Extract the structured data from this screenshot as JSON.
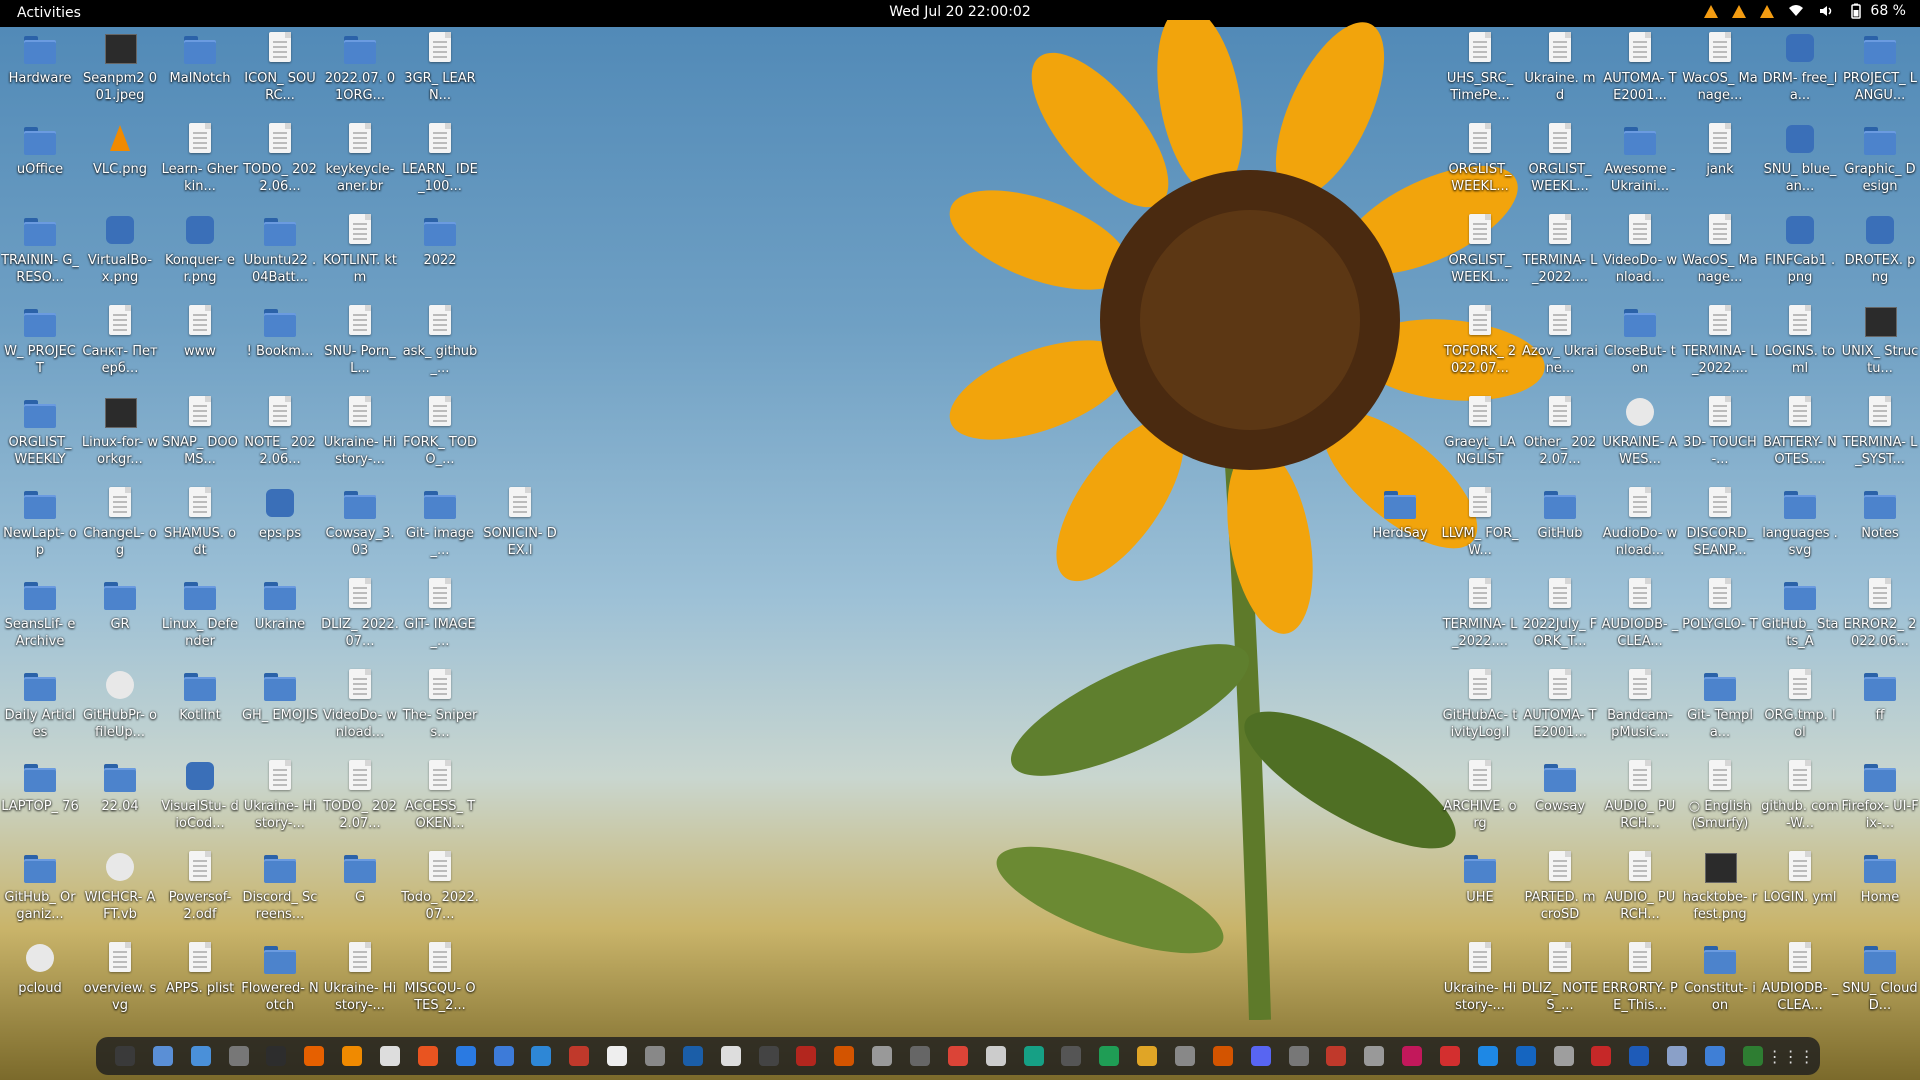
{
  "topbar": {
    "activities": "Activities",
    "clock": "Wed Jul 20  22:00:02",
    "battery": "68 %"
  },
  "desktop_left": [
    {
      "label": "Hardware",
      "icon": "folder-icon"
    },
    {
      "label": "Seanpm2 001.jpeg",
      "icon": "image-icon"
    },
    {
      "label": "MalNotch",
      "icon": "folder-icon"
    },
    {
      "label": "ICON_ SOURC...",
      "icon": "file-icon"
    },
    {
      "label": "2022.07. 01ORG...",
      "icon": "folder-icon"
    },
    {
      "label": "3GR_ LEARN...",
      "icon": "file-icon"
    },
    {
      "label": "uOffice",
      "icon": "folder-icon"
    },
    {
      "label": "VLC.png",
      "icon": "vlc-icon"
    },
    {
      "label": "Learn- Gherkin...",
      "icon": "file-icon"
    },
    {
      "label": "TODO_ 2022.06...",
      "icon": "file-icon"
    },
    {
      "label": "keykeycle- aner.br",
      "icon": "file-icon"
    },
    {
      "label": "LEARN_ IDE_100...",
      "icon": "file-icon"
    },
    {
      "label": "TRAININ- G_RESO...",
      "icon": "folder-icon"
    },
    {
      "label": "VirtualBo- x.png",
      "icon": "app-icon"
    },
    {
      "label": "Konquer- er.png",
      "icon": "app-icon"
    },
    {
      "label": "Ubuntu22 .04Batt...",
      "icon": "folder-icon"
    },
    {
      "label": "KOTLINT. ktm",
      "icon": "file-icon"
    },
    {
      "label": "2022",
      "icon": "folder-icon"
    },
    {
      "label": "W_ PROJECT",
      "icon": "folder-icon"
    },
    {
      "label": "Санкт- Петерб...",
      "icon": "file-icon"
    },
    {
      "label": "www",
      "icon": "file-icon"
    },
    {
      "label": "! Bookm...",
      "icon": "folder-icon"
    },
    {
      "label": "SNU- Porn_L...",
      "icon": "file-icon"
    },
    {
      "label": "ask_ github_...",
      "icon": "file-icon"
    },
    {
      "label": "ORGLIST_ WEEKLY",
      "icon": "folder-icon"
    },
    {
      "label": "Linux-for- workgr...",
      "icon": "image-icon"
    },
    {
      "label": "SNAP_ DOOMS...",
      "icon": "file-icon"
    },
    {
      "label": "NOTE_ 2022.06...",
      "icon": "file-icon"
    },
    {
      "label": "Ukraine- History-...",
      "icon": "file-icon"
    },
    {
      "label": "FORK_ TODO_...",
      "icon": "file-icon"
    },
    {
      "label": "NewLapt- op",
      "icon": "folder-icon"
    },
    {
      "label": "ChangeL- og",
      "icon": "file-icon"
    },
    {
      "label": "SHAMUS. odt",
      "icon": "file-icon"
    },
    {
      "label": "eps.ps",
      "icon": "app-icon"
    },
    {
      "label": "Cowsay_3. 03",
      "icon": "folder-icon"
    },
    {
      "label": "Git- image_...",
      "icon": "folder-icon"
    },
    {
      "label": "SeansLif- eArchive",
      "icon": "folder-icon"
    },
    {
      "label": "GR",
      "icon": "folder-icon"
    },
    {
      "label": "Linux_ Defender",
      "icon": "folder-icon"
    },
    {
      "label": "Ukraine",
      "icon": "folder-icon"
    },
    {
      "label": "DLIZ_ 2022.07...",
      "icon": "file-icon"
    },
    {
      "label": "GIT- IMAGE_...",
      "icon": "file-icon"
    },
    {
      "label": "Daily Articles",
      "icon": "folder-icon"
    },
    {
      "label": "GitHubPr- ofileUp...",
      "icon": "gear-icon"
    },
    {
      "label": "Kotlint",
      "icon": "folder-icon"
    },
    {
      "label": "GH_ EMOJIS",
      "icon": "folder-icon"
    },
    {
      "label": "VideoDo- wnload...",
      "icon": "file-icon"
    },
    {
      "label": "The- Snipers...",
      "icon": "file-icon"
    },
    {
      "label": "LAPTOP_ 76",
      "icon": "folder-icon"
    },
    {
      "label": "22.04",
      "icon": "folder-icon"
    },
    {
      "label": "VisualStu- dioCod...",
      "icon": "app-icon"
    },
    {
      "label": "Ukraine- History-...",
      "icon": "file-icon"
    },
    {
      "label": "TODO_ 2022.07...",
      "icon": "file-icon"
    },
    {
      "label": "ACCESS_ TOKEN...",
      "icon": "file-icon"
    },
    {
      "label": "GitHub_ Organiz...",
      "icon": "folder-icon"
    },
    {
      "label": "WICHCR- AFT.vb",
      "icon": "gear-icon"
    },
    {
      "label": "Powersof- 2.odf",
      "icon": "file-icon"
    },
    {
      "label": "Discord_ Screens...",
      "icon": "folder-icon"
    },
    {
      "label": "G",
      "icon": "folder-icon"
    },
    {
      "label": "Todo_ 2022.07...",
      "icon": "file-icon"
    },
    {
      "label": "pcloud",
      "icon": "gear-icon"
    },
    {
      "label": "overview. svg",
      "icon": "file-icon"
    },
    {
      "label": "APPS. plist",
      "icon": "file-icon"
    },
    {
      "label": "Flowered- Notch",
      "icon": "folder-icon"
    },
    {
      "label": "Ukraine- History-...",
      "icon": "file-icon"
    },
    {
      "label": "MISCQU- OTES_2...",
      "icon": "file-icon"
    }
  ],
  "desktop_left_extra": {
    "label": "SONICIN- DEX.l",
    "icon": "file-icon"
  },
  "desktop_right": [
    {
      "label": "UHS_SRC_ TimePe...",
      "icon": "file-icon"
    },
    {
      "label": "Ukraine. md",
      "icon": "file-icon"
    },
    {
      "label": "AUTOMA- TE2001...",
      "icon": "file-icon"
    },
    {
      "label": "WacOS_ Manage...",
      "icon": "file-icon"
    },
    {
      "label": "DRM- free_la...",
      "icon": "app-icon"
    },
    {
      "label": "PROJECT_ LANGU...",
      "icon": "folder-icon"
    },
    {
      "label": "ORGLIST_ WEEKL...",
      "icon": "file-icon"
    },
    {
      "label": "ORGLIST_ WEEKL...",
      "icon": "file-icon"
    },
    {
      "label": "Awesome -Ukraini...",
      "icon": "folder-icon"
    },
    {
      "label": "jank",
      "icon": "file-icon"
    },
    {
      "label": "SNU_ blue_an...",
      "icon": "app-icon"
    },
    {
      "label": "Graphic_ Design",
      "icon": "folder-icon"
    },
    {
      "label": "ORGLIST_ WEEKL...",
      "icon": "file-icon"
    },
    {
      "label": "TERMINA- L_2022....",
      "icon": "file-icon"
    },
    {
      "label": "VideoDo- wnload...",
      "icon": "file-icon"
    },
    {
      "label": "WacOS_ Manage...",
      "icon": "file-icon"
    },
    {
      "label": "FINFCab1 .png",
      "icon": "app-icon"
    },
    {
      "label": "DROTEX. png",
      "icon": "app-icon"
    },
    {
      "label": "TOFORK_ 2022.07...",
      "icon": "file-icon"
    },
    {
      "label": "Azov_ Ukraine...",
      "icon": "file-icon"
    },
    {
      "label": "CloseBut- ton",
      "icon": "folder-icon"
    },
    {
      "label": "TERMINA- L_2022....",
      "icon": "file-icon"
    },
    {
      "label": "LOGINS. toml",
      "icon": "file-icon"
    },
    {
      "label": "UNIX_ Structu...",
      "icon": "image-icon"
    },
    {
      "label": "Graeyt_ LANGLIST",
      "icon": "file-icon"
    },
    {
      "label": "Other_ 2022.07...",
      "icon": "file-icon"
    },
    {
      "label": "UKRAINE- AWES...",
      "icon": "gear-icon"
    },
    {
      "label": "3D- TOUCH-...",
      "icon": "file-icon"
    },
    {
      "label": "BATTERY- NOTES....",
      "icon": "file-icon"
    },
    {
      "label": "TERMINA- L_SYST...",
      "icon": "file-icon"
    },
    {
      "label": "LLVM_ FOR_W...",
      "icon": "file-icon"
    },
    {
      "label": "GitHub",
      "icon": "folder-icon"
    },
    {
      "label": "AudioDo- wnload...",
      "icon": "file-icon"
    },
    {
      "label": "DISCORD_ SEANP...",
      "icon": "file-icon"
    },
    {
      "label": "languages .svg",
      "icon": "folder-icon"
    },
    {
      "label": "Notes",
      "icon": "folder-icon"
    },
    {
      "label": "TERMINA- L_2022....",
      "icon": "file-icon"
    },
    {
      "label": "2022July_ FORK_T...",
      "icon": "file-icon"
    },
    {
      "label": "AUDIODB- _CLEA...",
      "icon": "file-icon"
    },
    {
      "label": "POLYGLO- T",
      "icon": "file-icon"
    },
    {
      "label": "GitHub_ Stats_A",
      "icon": "folder-icon"
    },
    {
      "label": "ERROR2_ 2022.06...",
      "icon": "file-icon"
    },
    {
      "label": "GitHubAc- tivityLog.l",
      "icon": "file-icon"
    },
    {
      "label": "AUTOMA- TE2001...",
      "icon": "file-icon"
    },
    {
      "label": "Bandcam- pMusic...",
      "icon": "file-icon"
    },
    {
      "label": "Git- Templa...",
      "icon": "folder-icon"
    },
    {
      "label": "ORG.tmp. lol",
      "icon": "file-icon"
    },
    {
      "label": "ff",
      "icon": "folder-icon"
    },
    {
      "label": "ARCHIVE. org",
      "icon": "file-icon"
    },
    {
      "label": "Cowsay",
      "icon": "folder-icon"
    },
    {
      "label": "AUDIO_ PURCH...",
      "icon": "file-icon"
    },
    {
      "label": "○ English (Smurfy)",
      "icon": "file-icon"
    },
    {
      "label": "github. com-W...",
      "icon": "file-icon"
    },
    {
      "label": "Firefox- UI-Fix-...",
      "icon": "folder-icon"
    },
    {
      "label": "UHE",
      "icon": "folder-icon"
    },
    {
      "label": "PARTED. mcroSD",
      "icon": "file-icon"
    },
    {
      "label": "AUDIO_ PURCH...",
      "icon": "file-icon"
    },
    {
      "label": "hacktobe- rfest.png",
      "icon": "image-icon"
    },
    {
      "label": "LOGIN. yml",
      "icon": "file-icon"
    },
    {
      "label": "Home",
      "icon": "folder-icon"
    },
    {
      "label": "Ukraine- History-...",
      "icon": "file-icon"
    },
    {
      "label": "DLIZ_ NOTES_...",
      "icon": "file-icon"
    },
    {
      "label": "ERRORTY- PE_This...",
      "icon": "file-icon"
    },
    {
      "label": "Constitut- ion",
      "icon": "folder-icon"
    },
    {
      "label": "AUDIODB- _CLEA...",
      "icon": "file-icon"
    },
    {
      "label": "SNU_ CloudD...",
      "icon": "folder-icon"
    }
  ],
  "desktop_right_extra": {
    "label": "HerdSay",
    "icon": "folder-icon"
  },
  "dock": {
    "apps_grid": "⋮⋮⋮",
    "items": [
      {
        "name": "terminal-icon",
        "color": "#3a3a3a"
      },
      {
        "name": "files-icon",
        "color": "#5a8fd6"
      },
      {
        "name": "text-editor-icon",
        "color": "#4a90d9"
      },
      {
        "name": "calculator-icon",
        "color": "#777777"
      },
      {
        "name": "console-icon",
        "color": "#2d2d2d"
      },
      {
        "name": "firefox-icon",
        "color": "#e66000"
      },
      {
        "name": "vlc-icon",
        "color": "#f08a00"
      },
      {
        "name": "chromium-icon",
        "color": "#dddddd"
      },
      {
        "name": "software-icon",
        "color": "#e95420"
      },
      {
        "name": "writer-icon",
        "color": "#2a7ae2"
      },
      {
        "name": "notes-icon",
        "color": "#3d7bd9"
      },
      {
        "name": "help-icon",
        "color": "#2e87d6"
      },
      {
        "name": "monitor-icon",
        "color": "#c0392b"
      },
      {
        "name": "document-icon",
        "color": "#eeeeee"
      },
      {
        "name": "pen-icon",
        "color": "#888888"
      },
      {
        "name": "virtualbox-icon",
        "color": "#1b5ea8"
      },
      {
        "name": "github-icon",
        "color": "#dddddd"
      },
      {
        "name": "inkscape-icon",
        "color": "#444444"
      },
      {
        "name": "ruby-icon",
        "color": "#b3261e"
      },
      {
        "name": "fox-icon",
        "color": "#d35400"
      },
      {
        "name": "archive-icon",
        "color": "#999999"
      },
      {
        "name": "screenshot-icon",
        "color": "#666666"
      },
      {
        "name": "chrome-icon",
        "color": "#db4437"
      },
      {
        "name": "paper-icon",
        "color": "#cccccc"
      },
      {
        "name": "photos-icon",
        "color": "#16a085"
      },
      {
        "name": "camera-icon",
        "color": "#555555"
      },
      {
        "name": "calc-sheet-icon",
        "color": "#1f9d55"
      },
      {
        "name": "folder-dock-icon",
        "color": "#e0a526"
      },
      {
        "name": "disk-icon",
        "color": "#888888"
      },
      {
        "name": "impress-icon",
        "color": "#d35400"
      },
      {
        "name": "discord-icon",
        "color": "#5865f2"
      },
      {
        "name": "steam-icon",
        "color": "#777777"
      },
      {
        "name": "pdf-icon",
        "color": "#c0392b"
      },
      {
        "name": "formula-icon",
        "color": "#999999"
      },
      {
        "name": "media-icon",
        "color": "#c2185b"
      },
      {
        "name": "gift-icon",
        "color": "#d32f2f"
      },
      {
        "name": "store-icon",
        "color": "#1e88e5"
      },
      {
        "name": "window-icon",
        "color": "#1565c0"
      },
      {
        "name": "accessibility-icon",
        "color": "#9e9e9e"
      },
      {
        "name": "heart-icon",
        "color": "#c62828"
      },
      {
        "name": "word-icon",
        "color": "#1e5bb8"
      },
      {
        "name": "grid-doc-icon",
        "color": "#8aa0c8"
      },
      {
        "name": "blue-doc-icon",
        "color": "#3f7fd6"
      },
      {
        "name": "trash-icon",
        "color": "#2e7d32"
      }
    ]
  }
}
